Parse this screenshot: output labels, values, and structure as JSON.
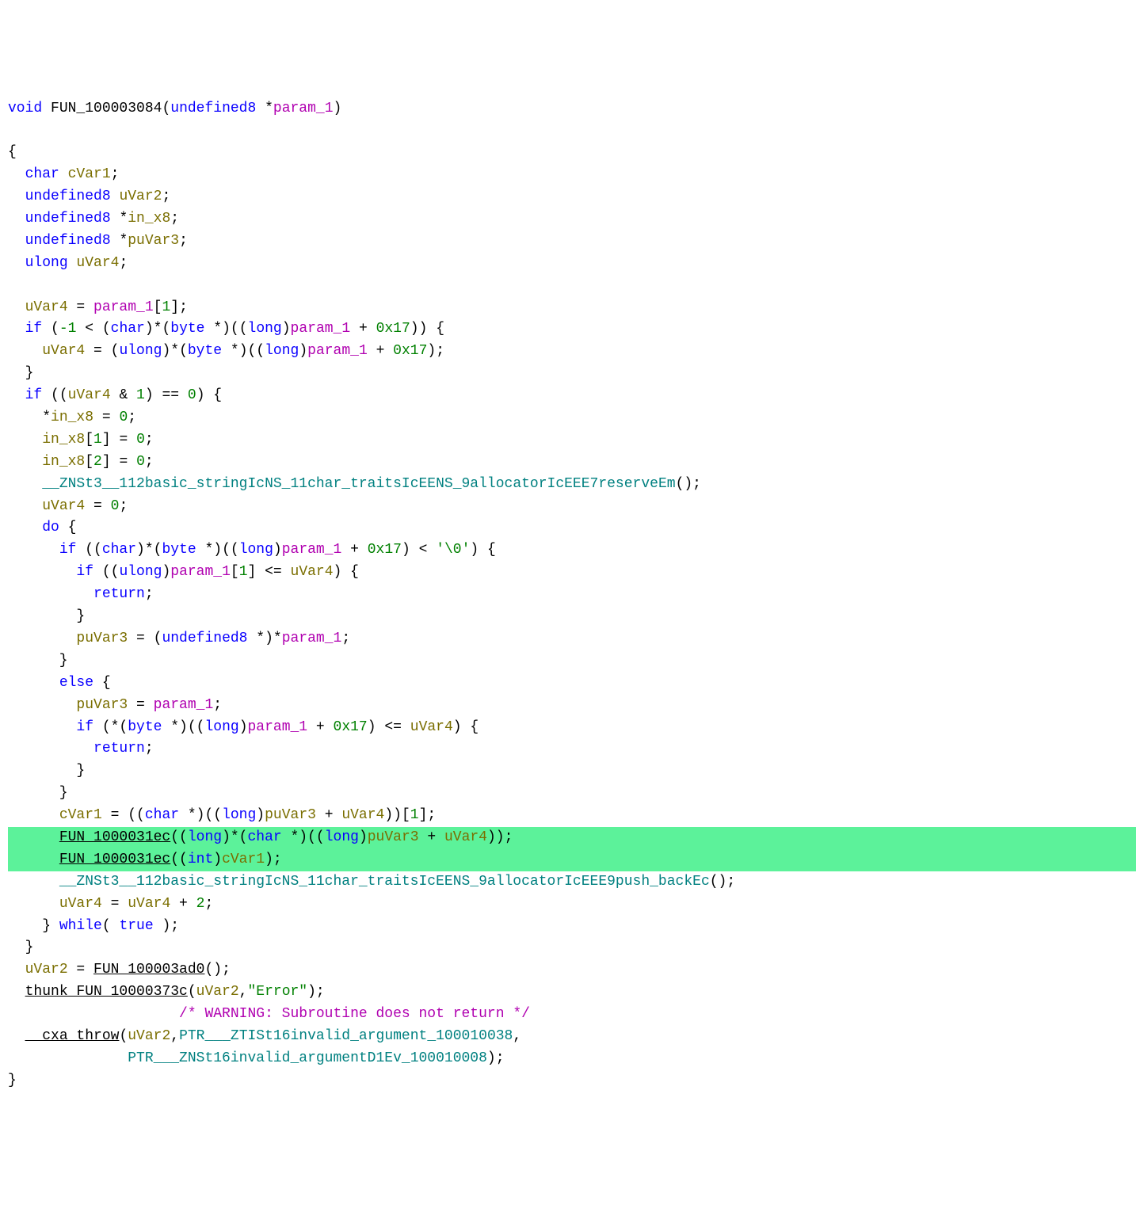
{
  "code": {
    "tokens": [
      [
        [
          "void ",
          "kw"
        ],
        [
          "FUN_100003084",
          "func"
        ],
        [
          "(",
          "op"
        ],
        [
          "undefined8 ",
          "type"
        ],
        [
          "*",
          "op"
        ],
        [
          "param_1",
          "param"
        ],
        [
          ")",
          "op"
        ]
      ],
      [
        [
          "",
          ""
        ]
      ],
      [
        [
          "{",
          "op"
        ]
      ],
      [
        [
          "  ",
          "op"
        ],
        [
          "char ",
          "type"
        ],
        [
          "cVar1",
          "var"
        ],
        [
          ";",
          ""
        ]
      ],
      [
        [
          "  ",
          "op"
        ],
        [
          "undefined8 ",
          "type"
        ],
        [
          "uVar2",
          "var"
        ],
        [
          ";",
          ""
        ]
      ],
      [
        [
          "  ",
          "op"
        ],
        [
          "undefined8 ",
          "type"
        ],
        [
          "*",
          "op"
        ],
        [
          "in_x8",
          "var"
        ],
        [
          ";",
          ""
        ]
      ],
      [
        [
          "  ",
          "op"
        ],
        [
          "undefined8 ",
          "type"
        ],
        [
          "*",
          "op"
        ],
        [
          "puVar3",
          "var"
        ],
        [
          ";",
          ""
        ]
      ],
      [
        [
          "  ",
          "op"
        ],
        [
          "ulong ",
          "type"
        ],
        [
          "uVar4",
          "var"
        ],
        [
          ";",
          ""
        ]
      ],
      [
        [
          "",
          ""
        ]
      ],
      [
        [
          "  ",
          "op"
        ],
        [
          "uVar4",
          "var"
        ],
        [
          " = ",
          "op"
        ],
        [
          "param_1",
          "param"
        ],
        [
          "[",
          "op"
        ],
        [
          "1",
          "num"
        ],
        [
          "];",
          ""
        ]
      ],
      [
        [
          "  ",
          "op"
        ],
        [
          "if ",
          "kw"
        ],
        [
          "(",
          "op"
        ],
        [
          "-1",
          "num"
        ],
        [
          " < (",
          "op"
        ],
        [
          "char",
          "type"
        ],
        [
          ")*(",
          "op"
        ],
        [
          "byte ",
          "type"
        ],
        [
          "*)((",
          "op"
        ],
        [
          "long",
          "type"
        ],
        [
          ")",
          "op"
        ],
        [
          "param_1",
          "param"
        ],
        [
          " + ",
          "op"
        ],
        [
          "0x17",
          "num"
        ],
        [
          ")) {",
          "op"
        ]
      ],
      [
        [
          "    ",
          "op"
        ],
        [
          "uVar4",
          "var"
        ],
        [
          " = (",
          "op"
        ],
        [
          "ulong",
          "type"
        ],
        [
          ")*(",
          "op"
        ],
        [
          "byte ",
          "type"
        ],
        [
          "*)((",
          "op"
        ],
        [
          "long",
          "type"
        ],
        [
          ")",
          "op"
        ],
        [
          "param_1",
          "param"
        ],
        [
          " + ",
          "op"
        ],
        [
          "0x17",
          "num"
        ],
        [
          ");",
          "op"
        ]
      ],
      [
        [
          "  }",
          "op"
        ]
      ],
      [
        [
          "  ",
          "op"
        ],
        [
          "if ",
          "kw"
        ],
        [
          "((",
          "op"
        ],
        [
          "uVar4",
          "var"
        ],
        [
          " & ",
          "op"
        ],
        [
          "1",
          "num"
        ],
        [
          ") == ",
          "op"
        ],
        [
          "0",
          "num"
        ],
        [
          ") {",
          "op"
        ]
      ],
      [
        [
          "    *",
          "op"
        ],
        [
          "in_x8",
          "var"
        ],
        [
          " = ",
          "op"
        ],
        [
          "0",
          "num"
        ],
        [
          ";",
          ""
        ]
      ],
      [
        [
          "    ",
          "op"
        ],
        [
          "in_x8",
          "var"
        ],
        [
          "[",
          "op"
        ],
        [
          "1",
          "num"
        ],
        [
          "] = ",
          "op"
        ],
        [
          "0",
          "num"
        ],
        [
          ";",
          ""
        ]
      ],
      [
        [
          "    ",
          "op"
        ],
        [
          "in_x8",
          "var"
        ],
        [
          "[",
          "op"
        ],
        [
          "2",
          "num"
        ],
        [
          "] = ",
          "op"
        ],
        [
          "0",
          "num"
        ],
        [
          ";",
          ""
        ]
      ],
      [
        [
          "    ",
          "op"
        ],
        [
          "__ZNSt3__112basic_stringIcNS_11char_traitsIcEENS_9allocatorIcEEE7reserveEm",
          "ident"
        ],
        [
          "();",
          ""
        ]
      ],
      [
        [
          "    ",
          "op"
        ],
        [
          "uVar4",
          "var"
        ],
        [
          " = ",
          "op"
        ],
        [
          "0",
          "num"
        ],
        [
          ";",
          ""
        ]
      ],
      [
        [
          "    ",
          "op"
        ],
        [
          "do ",
          "kw"
        ],
        [
          "{",
          "op"
        ]
      ],
      [
        [
          "      ",
          "op"
        ],
        [
          "if ",
          "kw"
        ],
        [
          "((",
          "op"
        ],
        [
          "char",
          "type"
        ],
        [
          ")*(",
          "op"
        ],
        [
          "byte ",
          "type"
        ],
        [
          "*)((",
          "op"
        ],
        [
          "long",
          "type"
        ],
        [
          ")",
          "op"
        ],
        [
          "param_1",
          "param"
        ],
        [
          " + ",
          "op"
        ],
        [
          "0x17",
          "num"
        ],
        [
          ") < ",
          "op"
        ],
        [
          "'\\0'",
          "str"
        ],
        [
          ") {",
          "op"
        ]
      ],
      [
        [
          "        ",
          "op"
        ],
        [
          "if ",
          "kw"
        ],
        [
          "((",
          "op"
        ],
        [
          "ulong",
          "type"
        ],
        [
          ")",
          "op"
        ],
        [
          "param_1",
          "param"
        ],
        [
          "[",
          "op"
        ],
        [
          "1",
          "num"
        ],
        [
          "] <= ",
          "op"
        ],
        [
          "uVar4",
          "var"
        ],
        [
          ") {",
          "op"
        ]
      ],
      [
        [
          "          ",
          "op"
        ],
        [
          "return",
          "kw"
        ],
        [
          ";",
          ""
        ]
      ],
      [
        [
          "        }",
          "op"
        ]
      ],
      [
        [
          "        ",
          "op"
        ],
        [
          "puVar3",
          "var"
        ],
        [
          " = (",
          "op"
        ],
        [
          "undefined8 ",
          "type"
        ],
        [
          "*)*",
          "op"
        ],
        [
          "param_1",
          "param"
        ],
        [
          ";",
          ""
        ]
      ],
      [
        [
          "      }",
          "op"
        ]
      ],
      [
        [
          "      ",
          "op"
        ],
        [
          "else ",
          "kw"
        ],
        [
          "{",
          "op"
        ]
      ],
      [
        [
          "        ",
          "op"
        ],
        [
          "puVar3",
          "var"
        ],
        [
          " = ",
          "op"
        ],
        [
          "param_1",
          "param"
        ],
        [
          ";",
          ""
        ]
      ],
      [
        [
          "        ",
          "op"
        ],
        [
          "if ",
          "kw"
        ],
        [
          "(*(",
          "op"
        ],
        [
          "byte ",
          "type"
        ],
        [
          "*)((",
          "op"
        ],
        [
          "long",
          "type"
        ],
        [
          ")",
          "op"
        ],
        [
          "param_1",
          "param"
        ],
        [
          " + ",
          "op"
        ],
        [
          "0x17",
          "num"
        ],
        [
          ") <= ",
          "op"
        ],
        [
          "uVar4",
          "var"
        ],
        [
          ") {",
          "op"
        ]
      ],
      [
        [
          "          ",
          "op"
        ],
        [
          "return",
          "kw"
        ],
        [
          ";",
          ""
        ]
      ],
      [
        [
          "        }",
          "op"
        ]
      ],
      [
        [
          "      }",
          "op"
        ]
      ],
      [
        [
          "      ",
          "op"
        ],
        [
          "cVar1",
          "var"
        ],
        [
          " = ((",
          "op"
        ],
        [
          "char ",
          "type"
        ],
        [
          "*)((",
          "op"
        ],
        [
          "long",
          "type"
        ],
        [
          ")",
          "op"
        ],
        [
          "puVar3",
          "var"
        ],
        [
          " + ",
          "op"
        ],
        [
          "uVar4",
          "var"
        ],
        [
          "))[",
          "op"
        ],
        [
          "1",
          "num"
        ],
        [
          "];",
          ""
        ]
      ],
      [
        [
          "      ",
          "op"
        ],
        [
          "FUN_1000031ec",
          "funcln"
        ],
        [
          "((",
          "op"
        ],
        [
          "long",
          "type"
        ],
        [
          ")*(",
          "op"
        ],
        [
          "char ",
          "type"
        ],
        [
          "*)((",
          "op"
        ],
        [
          "long",
          "type"
        ],
        [
          ")",
          "op"
        ],
        [
          "puVar3",
          "var"
        ],
        [
          " + ",
          "op"
        ],
        [
          "uVar4",
          "var"
        ],
        [
          "));",
          "op"
        ]
      ],
      [
        [
          "      ",
          "op"
        ],
        [
          "FUN_1000031ec",
          "funcln"
        ],
        [
          "((",
          "op"
        ],
        [
          "int",
          "type"
        ],
        [
          ")",
          "op"
        ],
        [
          "cVar1",
          "var"
        ],
        [
          ");",
          "op"
        ]
      ],
      [
        [
          "      ",
          "op"
        ],
        [
          "__ZNSt3__112basic_stringIcNS_11char_traitsIcEENS_9allocatorIcEEE9push_backEc",
          "ident"
        ],
        [
          "();",
          ""
        ]
      ],
      [
        [
          "      ",
          "op"
        ],
        [
          "uVar4",
          "var"
        ],
        [
          " = ",
          "op"
        ],
        [
          "uVar4",
          "var"
        ],
        [
          " + ",
          "op"
        ],
        [
          "2",
          "num"
        ],
        [
          ";",
          ""
        ]
      ],
      [
        [
          "    } ",
          "op"
        ],
        [
          "while",
          "kw"
        ],
        [
          "( ",
          "op"
        ],
        [
          "true ",
          "kw"
        ],
        [
          ");",
          "op"
        ]
      ],
      [
        [
          "  }",
          "op"
        ]
      ],
      [
        [
          "  ",
          "op"
        ],
        [
          "uVar2",
          "var"
        ],
        [
          " = ",
          "op"
        ],
        [
          "FUN_100003ad0",
          "funcln"
        ],
        [
          "();",
          ""
        ]
      ],
      [
        [
          "  ",
          "op"
        ],
        [
          "thunk_FUN_10000373c",
          "funcln"
        ],
        [
          "(",
          "op"
        ],
        [
          "uVar2",
          "var"
        ],
        [
          ",",
          "op"
        ],
        [
          "\"Error\"",
          "str"
        ],
        [
          ");",
          "op"
        ]
      ],
      [
        [
          "                    ",
          "op"
        ],
        [
          "/* WARNING: Subroutine does not return */",
          "comment"
        ]
      ],
      [
        [
          "  ",
          "op"
        ],
        [
          "__cxa_throw",
          "funcln"
        ],
        [
          "(",
          "op"
        ],
        [
          "uVar2",
          "var"
        ],
        [
          ",",
          "op"
        ],
        [
          "PTR___ZTISt16invalid_argument_100010038",
          "ident"
        ],
        [
          ",",
          "op"
        ]
      ],
      [
        [
          "              ",
          "op"
        ],
        [
          "PTR___ZNSt16invalid_argumentD1Ev_100010008",
          "ident"
        ],
        [
          ");",
          "op"
        ]
      ],
      [
        [
          "}",
          "op"
        ]
      ]
    ],
    "highlighted_lines": [
      33,
      34
    ]
  }
}
